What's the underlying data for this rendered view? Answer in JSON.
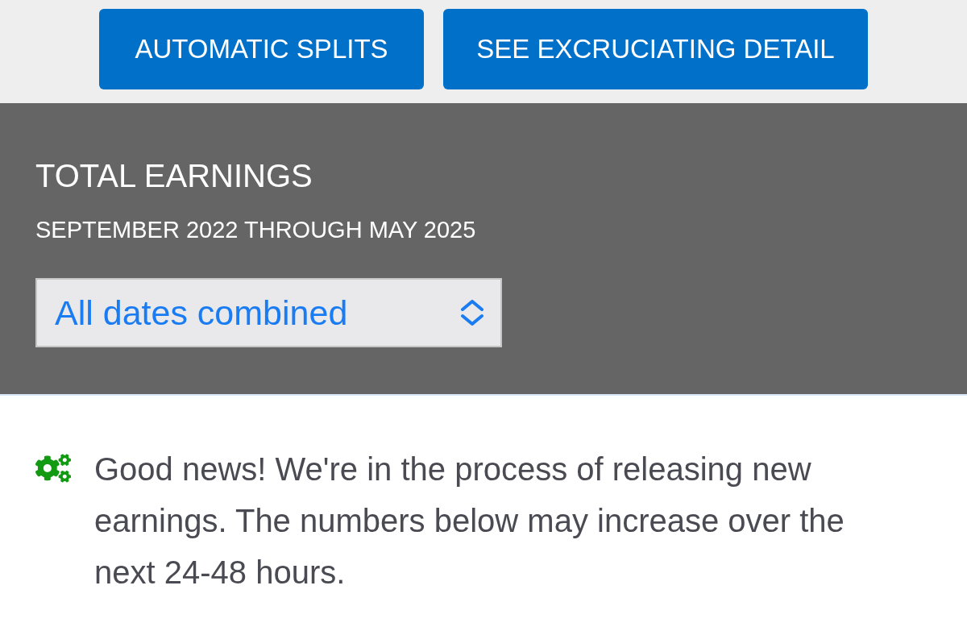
{
  "buttons": [
    {
      "label": "AUTOMATIC SPLITS"
    },
    {
      "label": "SEE EXCRUCIATING DETAIL"
    }
  ],
  "earnings": {
    "title": "TOTAL EARNINGS",
    "subtitle": "SEPTEMBER 2022 THROUGH MAY 2025",
    "date_select": {
      "value": "All dates combined"
    }
  },
  "notice": {
    "text": "Good news! We're in the process of releasing new earnings. The numbers below may increase over the next 24-48 hours."
  }
}
